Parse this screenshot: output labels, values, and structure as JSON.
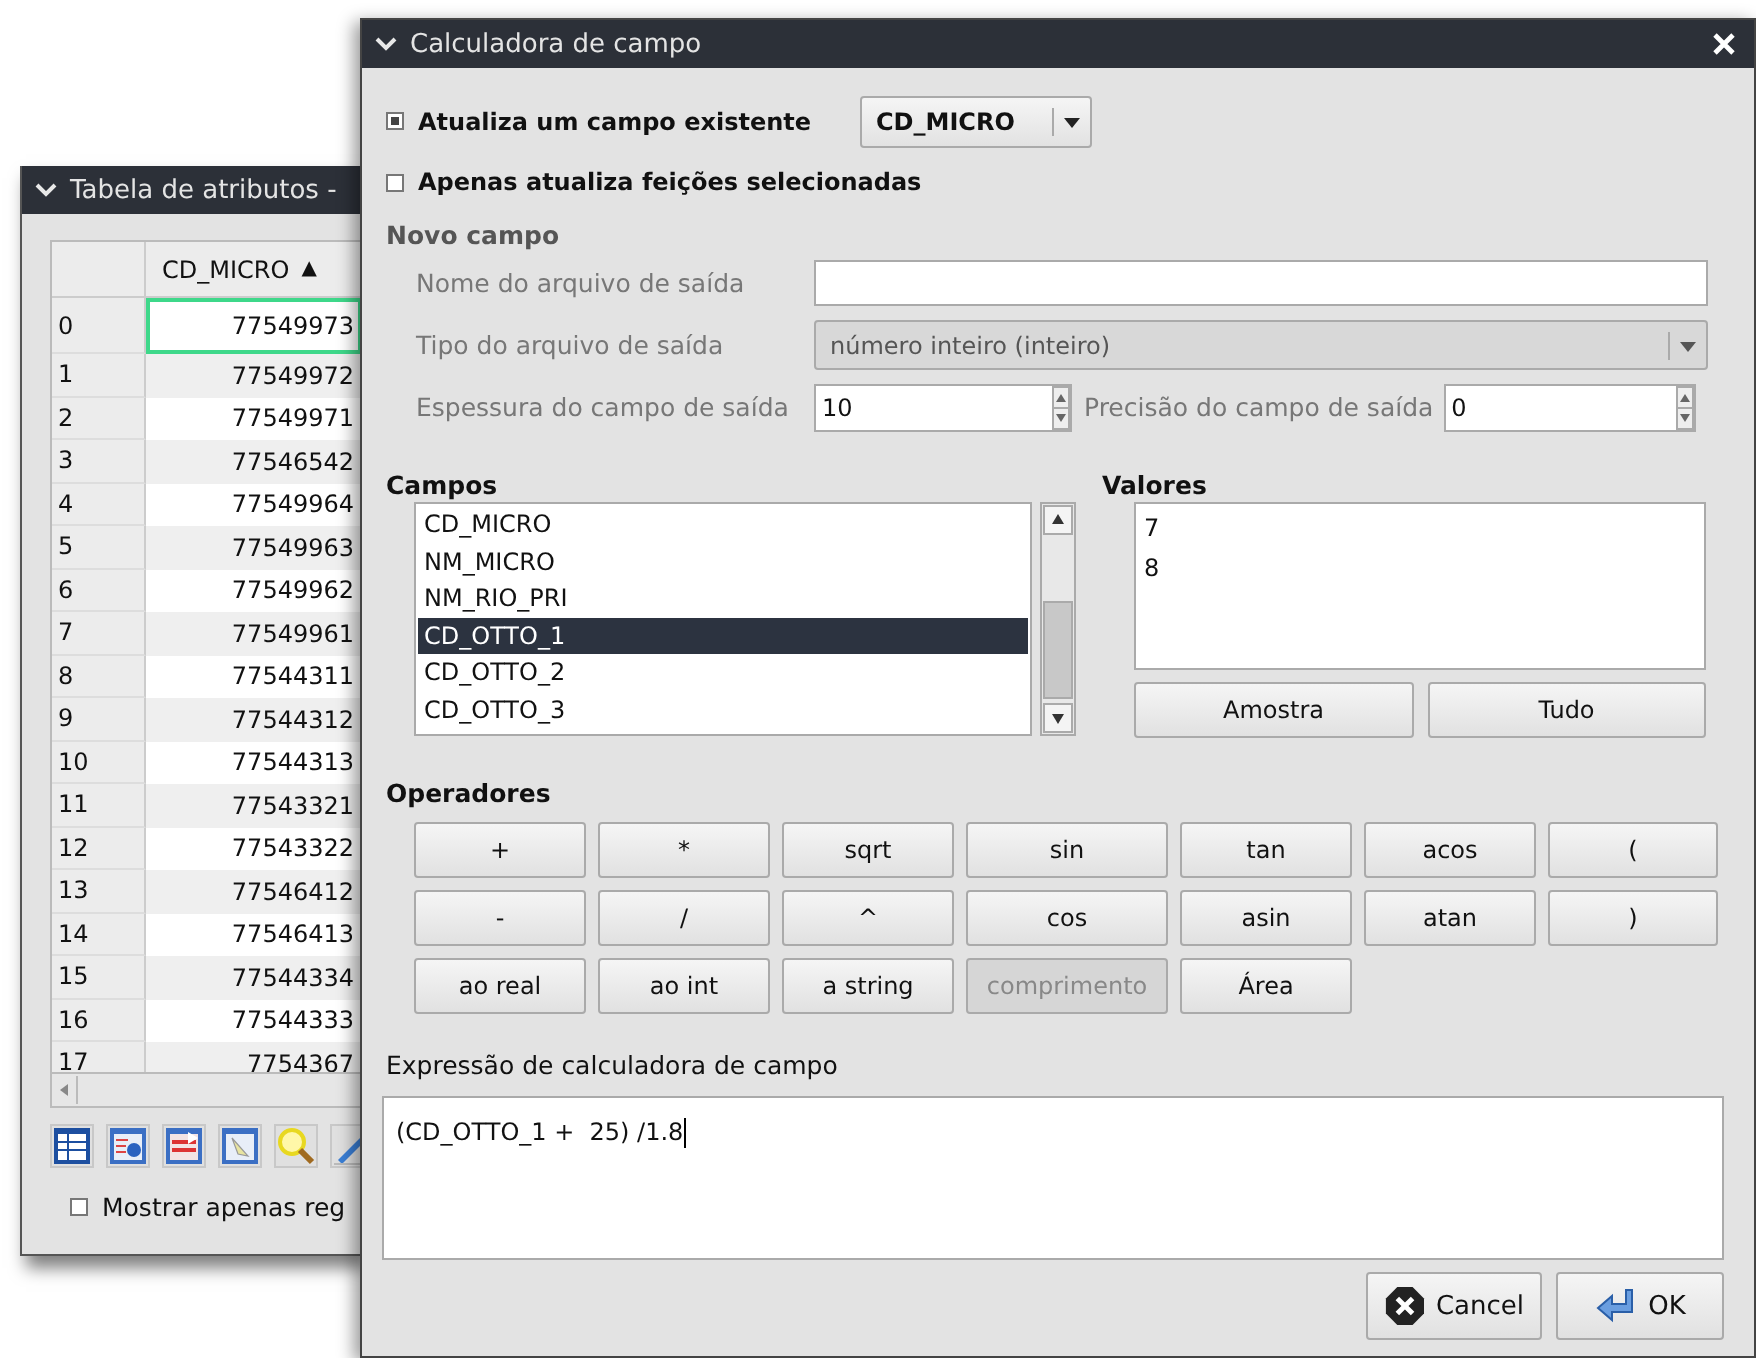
{
  "attribute_table": {
    "title": "Tabela de atributos -",
    "columns": [
      {
        "label": "CD_MICRO",
        "sort_indicator": "▲"
      }
    ],
    "rows": [
      {
        "number": "0",
        "value": "77549973",
        "current": true
      },
      {
        "number": "1",
        "value": "77549972",
        "current": false
      },
      {
        "number": "2",
        "value": "77549971",
        "current": false
      },
      {
        "number": "3",
        "value": "77546542",
        "current": false
      },
      {
        "number": "4",
        "value": "77549964",
        "current": false
      },
      {
        "number": "5",
        "value": "77549963",
        "current": false
      },
      {
        "number": "6",
        "value": "77549962",
        "current": false
      },
      {
        "number": "7",
        "value": "77549961",
        "current": false
      },
      {
        "number": "8",
        "value": "77544311",
        "current": false
      },
      {
        "number": "9",
        "value": "77544312",
        "current": false
      },
      {
        "number": "10",
        "value": "77544313",
        "current": false
      },
      {
        "number": "11",
        "value": "77543321",
        "current": false
      },
      {
        "number": "12",
        "value": "77543322",
        "current": false
      },
      {
        "number": "13",
        "value": "77546412",
        "current": false
      },
      {
        "number": "14",
        "value": "77546413",
        "current": false
      },
      {
        "number": "15",
        "value": "77544334",
        "current": false
      },
      {
        "number": "16",
        "value": "77544333",
        "current": false
      },
      {
        "number": "17",
        "value": "7754367",
        "current": false
      }
    ],
    "show_only": {
      "label": "Mostrar apenas reg",
      "checked": false
    }
  },
  "calculator": {
    "title": "Calculadora de campo",
    "update_existing": {
      "label": "Atualiza um campo existente",
      "checked": true,
      "field": "CD_MICRO"
    },
    "selected_only": {
      "label": "Apenas atualiza feições selecionadas",
      "checked": false
    },
    "new_field": {
      "title": "Novo campo",
      "disabled": true,
      "name_label": "Nome do arquivo de saída",
      "type_label": "Tipo do arquivo de saída",
      "type_value": "número inteiro (inteiro)",
      "width_label": "Espessura do campo de saída",
      "width_value": "10",
      "precision_label": "Precisão do campo de saída",
      "precision_value": "0"
    },
    "fields": {
      "title": "Campos",
      "items": [
        {
          "label": "CD_MICRO",
          "selected": false
        },
        {
          "label": "NM_MICRO",
          "selected": false
        },
        {
          "label": "NM_RIO_PRI",
          "selected": false
        },
        {
          "label": "CD_OTTO_1",
          "selected": true
        },
        {
          "label": "CD_OTTO_2",
          "selected": false
        },
        {
          "label": "CD_OTTO_3",
          "selected": false
        }
      ]
    },
    "values": {
      "title": "Valores",
      "items": [
        "7",
        "8"
      ],
      "buttons": [
        "Amostra",
        "Tudo"
      ]
    },
    "operators": {
      "title": "Operadores",
      "buttons": [
        {
          "label": "+",
          "disabled": false
        },
        {
          "label": "*",
          "disabled": false
        },
        {
          "label": "sqrt",
          "disabled": false
        },
        {
          "label": "sin",
          "disabled": false
        },
        {
          "label": "tan",
          "disabled": false
        },
        {
          "label": "acos",
          "disabled": false
        },
        {
          "label": "(",
          "disabled": false
        },
        {
          "label": "-",
          "disabled": false
        },
        {
          "label": "/",
          "disabled": false
        },
        {
          "label": "^",
          "disabled": false
        },
        {
          "label": "cos",
          "disabled": false
        },
        {
          "label": "asin",
          "disabled": false
        },
        {
          "label": "atan",
          "disabled": false
        },
        {
          "label": ")",
          "disabled": false
        },
        {
          "label": "ao real",
          "disabled": false
        },
        {
          "label": "ao int",
          "disabled": false
        },
        {
          "label": "a string",
          "disabled": false
        },
        {
          "label": "comprimento",
          "disabled": true
        },
        {
          "label": "Área",
          "disabled": false
        }
      ]
    },
    "expression": {
      "label": "Expressão de calculadora de campo",
      "value": "(CD_OTTO_1 +  25) /1.8"
    },
    "buttons": [
      {
        "label": "Cancel",
        "kind": "cancel"
      },
      {
        "label": "OK",
        "kind": "ok"
      }
    ]
  }
}
